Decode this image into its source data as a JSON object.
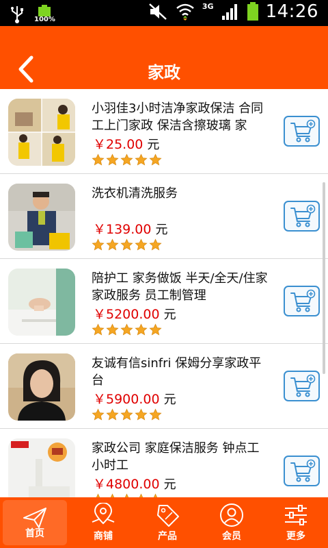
{
  "status_bar": {
    "battery_small_label": "100%",
    "network_label": "3G",
    "time": "14:26"
  },
  "header": {
    "title": "家政"
  },
  "colors": {
    "brand_orange": "#ff5000",
    "price_red": "#e00000",
    "cart_blue": "#3a8fd0",
    "star_orange": "#f5a623"
  },
  "items": [
    {
      "name": "小羽佳3小时洁净家政保洁 合同工上门家政 保洁含擦玻璃 家",
      "price": "￥25.00",
      "unit": "元",
      "rating": 5
    },
    {
      "name": "洗衣机清洗服务",
      "price": "￥139.00",
      "unit": "元",
      "rating": 5
    },
    {
      "name": "陪护工 家务做饭 半天/全天/住家 家政服务 员工制管理",
      "price": "￥5200.00",
      "unit": "元",
      "rating": 5
    },
    {
      "name": "友诚有信sinfri 保姆分享家政平台",
      "price": "￥5900.00",
      "unit": "元",
      "rating": 5
    },
    {
      "name": "家政公司 家庭保洁服务 钟点工 小时工",
      "price": "￥4800.00",
      "unit": "元",
      "rating": 5
    }
  ],
  "bottom_nav": [
    {
      "label": "首页",
      "icon": "paper-plane-icon"
    },
    {
      "label": "商铺",
      "icon": "map-pin-icon"
    },
    {
      "label": "产品",
      "icon": "sale-tag-icon"
    },
    {
      "label": "会员",
      "icon": "user-icon"
    },
    {
      "label": "更多",
      "icon": "sliders-icon"
    }
  ]
}
